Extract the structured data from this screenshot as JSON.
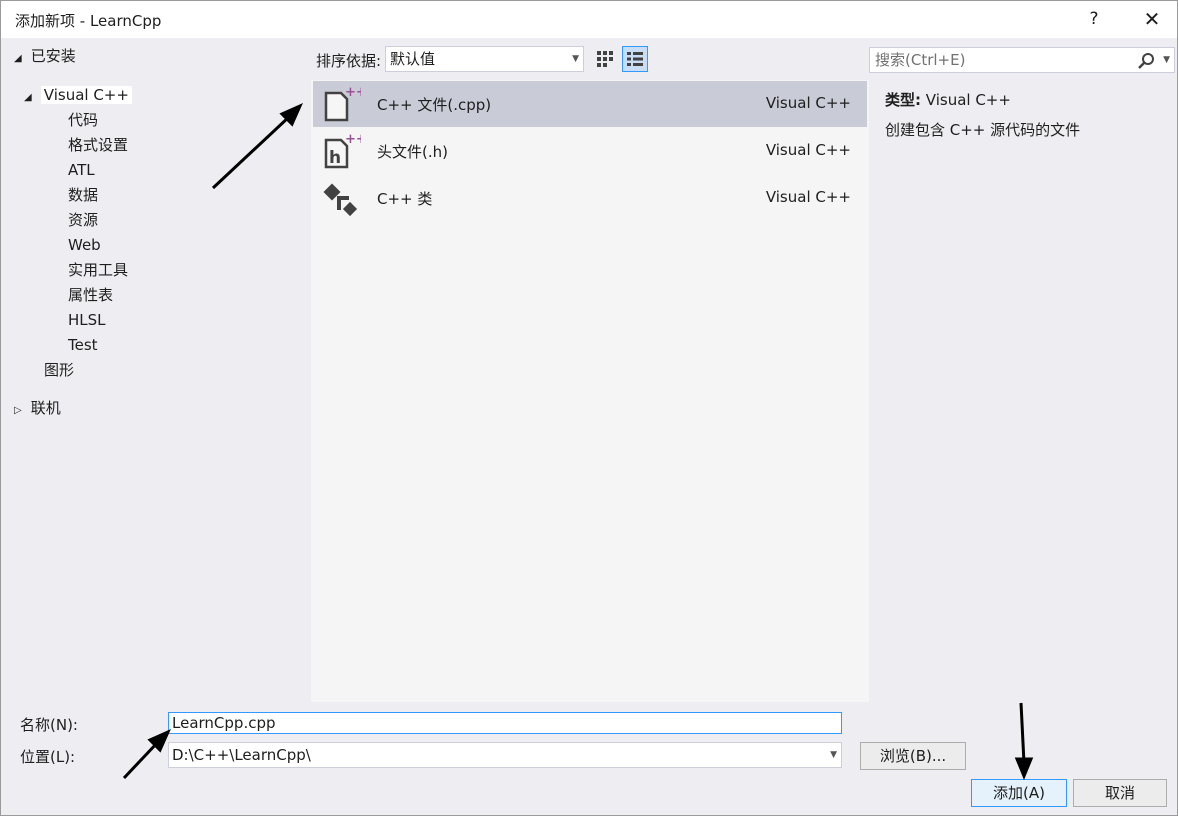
{
  "window": {
    "title": "添加新项 - LearnCpp",
    "help_label": "?",
    "close_label": "✕"
  },
  "tree": {
    "installed": "已安装",
    "visual_cpp": "Visual C++",
    "children": [
      "代码",
      "格式设置",
      "ATL",
      "数据",
      "资源",
      "Web",
      "实用工具",
      "属性表",
      "HLSL",
      "Test"
    ],
    "graphics": "图形",
    "online": "联机"
  },
  "toolbar": {
    "sort_label": "排序依据:",
    "sort_value": "默认值",
    "search_placeholder": "搜索(Ctrl+E)"
  },
  "templates": [
    {
      "name": "C++ 文件(.cpp)",
      "lang": "Visual C++",
      "icon": "cpp-file-icon"
    },
    {
      "name": "头文件(.h)",
      "lang": "Visual C++",
      "icon": "header-file-icon"
    },
    {
      "name": "C++ 类",
      "lang": "Visual C++",
      "icon": "cpp-class-icon"
    }
  ],
  "description": {
    "type_label": "类型:",
    "type_value": "Visual C++",
    "text": "创建包含 C++ 源代码的文件"
  },
  "form": {
    "name_label": "名称(N):",
    "name_value": "LearnCpp.cpp",
    "location_label": "位置(L):",
    "location_value": "D:\\C++\\LearnCpp\\",
    "browse_label": "浏览(B)...",
    "add_label": "添加(A)",
    "cancel_label": "取消"
  },
  "colors": {
    "selection": "#c9ccd7",
    "accent": "#3399ff",
    "icon_plus": "#9b4f96"
  }
}
